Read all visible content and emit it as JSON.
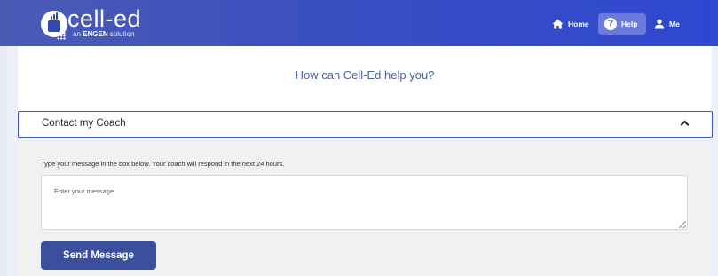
{
  "header": {
    "logo_text": "cell-ed",
    "logo_sub_prefix": "an",
    "logo_sub_brand": "ENGEN",
    "logo_sub_suffix": "solution",
    "nav": {
      "home": "Home",
      "help": "Help",
      "me": "Me"
    },
    "colors": {
      "bar_start": "#4a5bb5",
      "bar_end": "#2f47d1"
    }
  },
  "main": {
    "title": "How can Cell-Ed help you?",
    "accordion": {
      "label": "Contact my Coach",
      "expanded": true
    },
    "instructions": "Type your message in the box below. Your coach will respond in the next 24 hours.",
    "message_input": {
      "placeholder": "Enter your message",
      "value": ""
    },
    "send_button": "Send Message",
    "colors": {
      "accent": "#3f57c2",
      "button": "#3c4f9f",
      "title": "#4a62a8"
    }
  }
}
